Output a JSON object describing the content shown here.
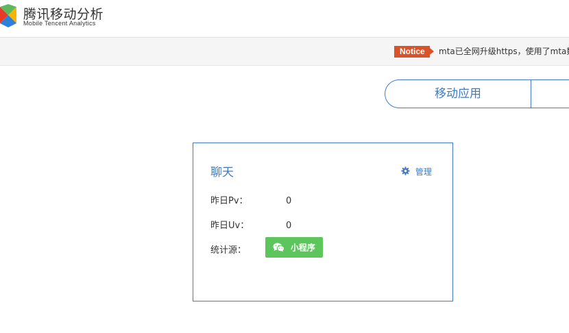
{
  "brand": {
    "title": "腾讯移动分析",
    "subtitle": "Mobile Tencent Analytics",
    "logo_icon": "mta-logo-icon"
  },
  "notice": {
    "badge": "Notice",
    "text": "mta已全网升级https，使用了mta数据"
  },
  "tabs": [
    {
      "label": "移动应用"
    },
    {
      "label": ""
    }
  ],
  "card": {
    "title": "聊天",
    "manage_label": "管理",
    "manage_icon": "gear-icon",
    "rows": [
      {
        "label": "昨日Pv：",
        "value": "0"
      },
      {
        "label": "昨日Uv：",
        "value": "0"
      }
    ],
    "source_label": "统计源：",
    "source_button": {
      "label": "小程序",
      "icon": "wechat-icon"
    }
  },
  "colors": {
    "accent": "#3e7bc3",
    "notice_badge": "#d9532a",
    "button_green": "#5cc65c"
  }
}
